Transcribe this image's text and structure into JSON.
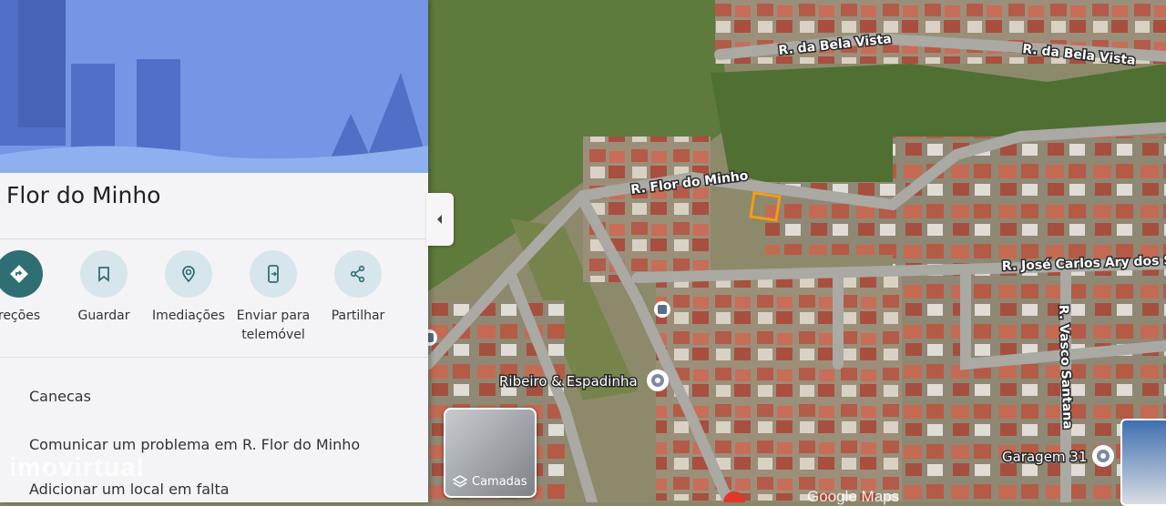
{
  "map": {
    "streets": [
      {
        "name": "R. da Bela Vista"
      },
      {
        "name": "R. da Bela Vista"
      },
      {
        "name": "R. Flor do Minho"
      },
      {
        "name": "R. José Carlos Ary dos Sa"
      },
      {
        "name": "R. Vasco Santana"
      }
    ],
    "pois": [
      {
        "name": "Ribeiro & Espadinha"
      },
      {
        "name": "Garagem 31"
      }
    ],
    "layers_label": "Camadas",
    "attribution": "Google Maps"
  },
  "panel": {
    "title": "Flor do Minho",
    "actions": [
      {
        "label": "reções",
        "icon": "directions-icon"
      },
      {
        "label": "Guardar",
        "icon": "bookmark-icon"
      },
      {
        "label": "Imediações",
        "icon": "nearby-icon"
      },
      {
        "label": "Enviar para\ntelemóvel",
        "icon": "send-to-phone-icon"
      },
      {
        "label": "Partilhar",
        "icon": "share-icon"
      }
    ],
    "list": [
      {
        "label": "Canecas"
      },
      {
        "label": "Comunicar um problema em R. Flor do Minho"
      },
      {
        "label": "Adicionar um local em falta"
      }
    ]
  },
  "watermark": "imovirtual",
  "colors": {
    "primary_action": "#2f6f73",
    "action_bg": "#d7e6ec",
    "highlight_parcel": "#f29d18"
  }
}
